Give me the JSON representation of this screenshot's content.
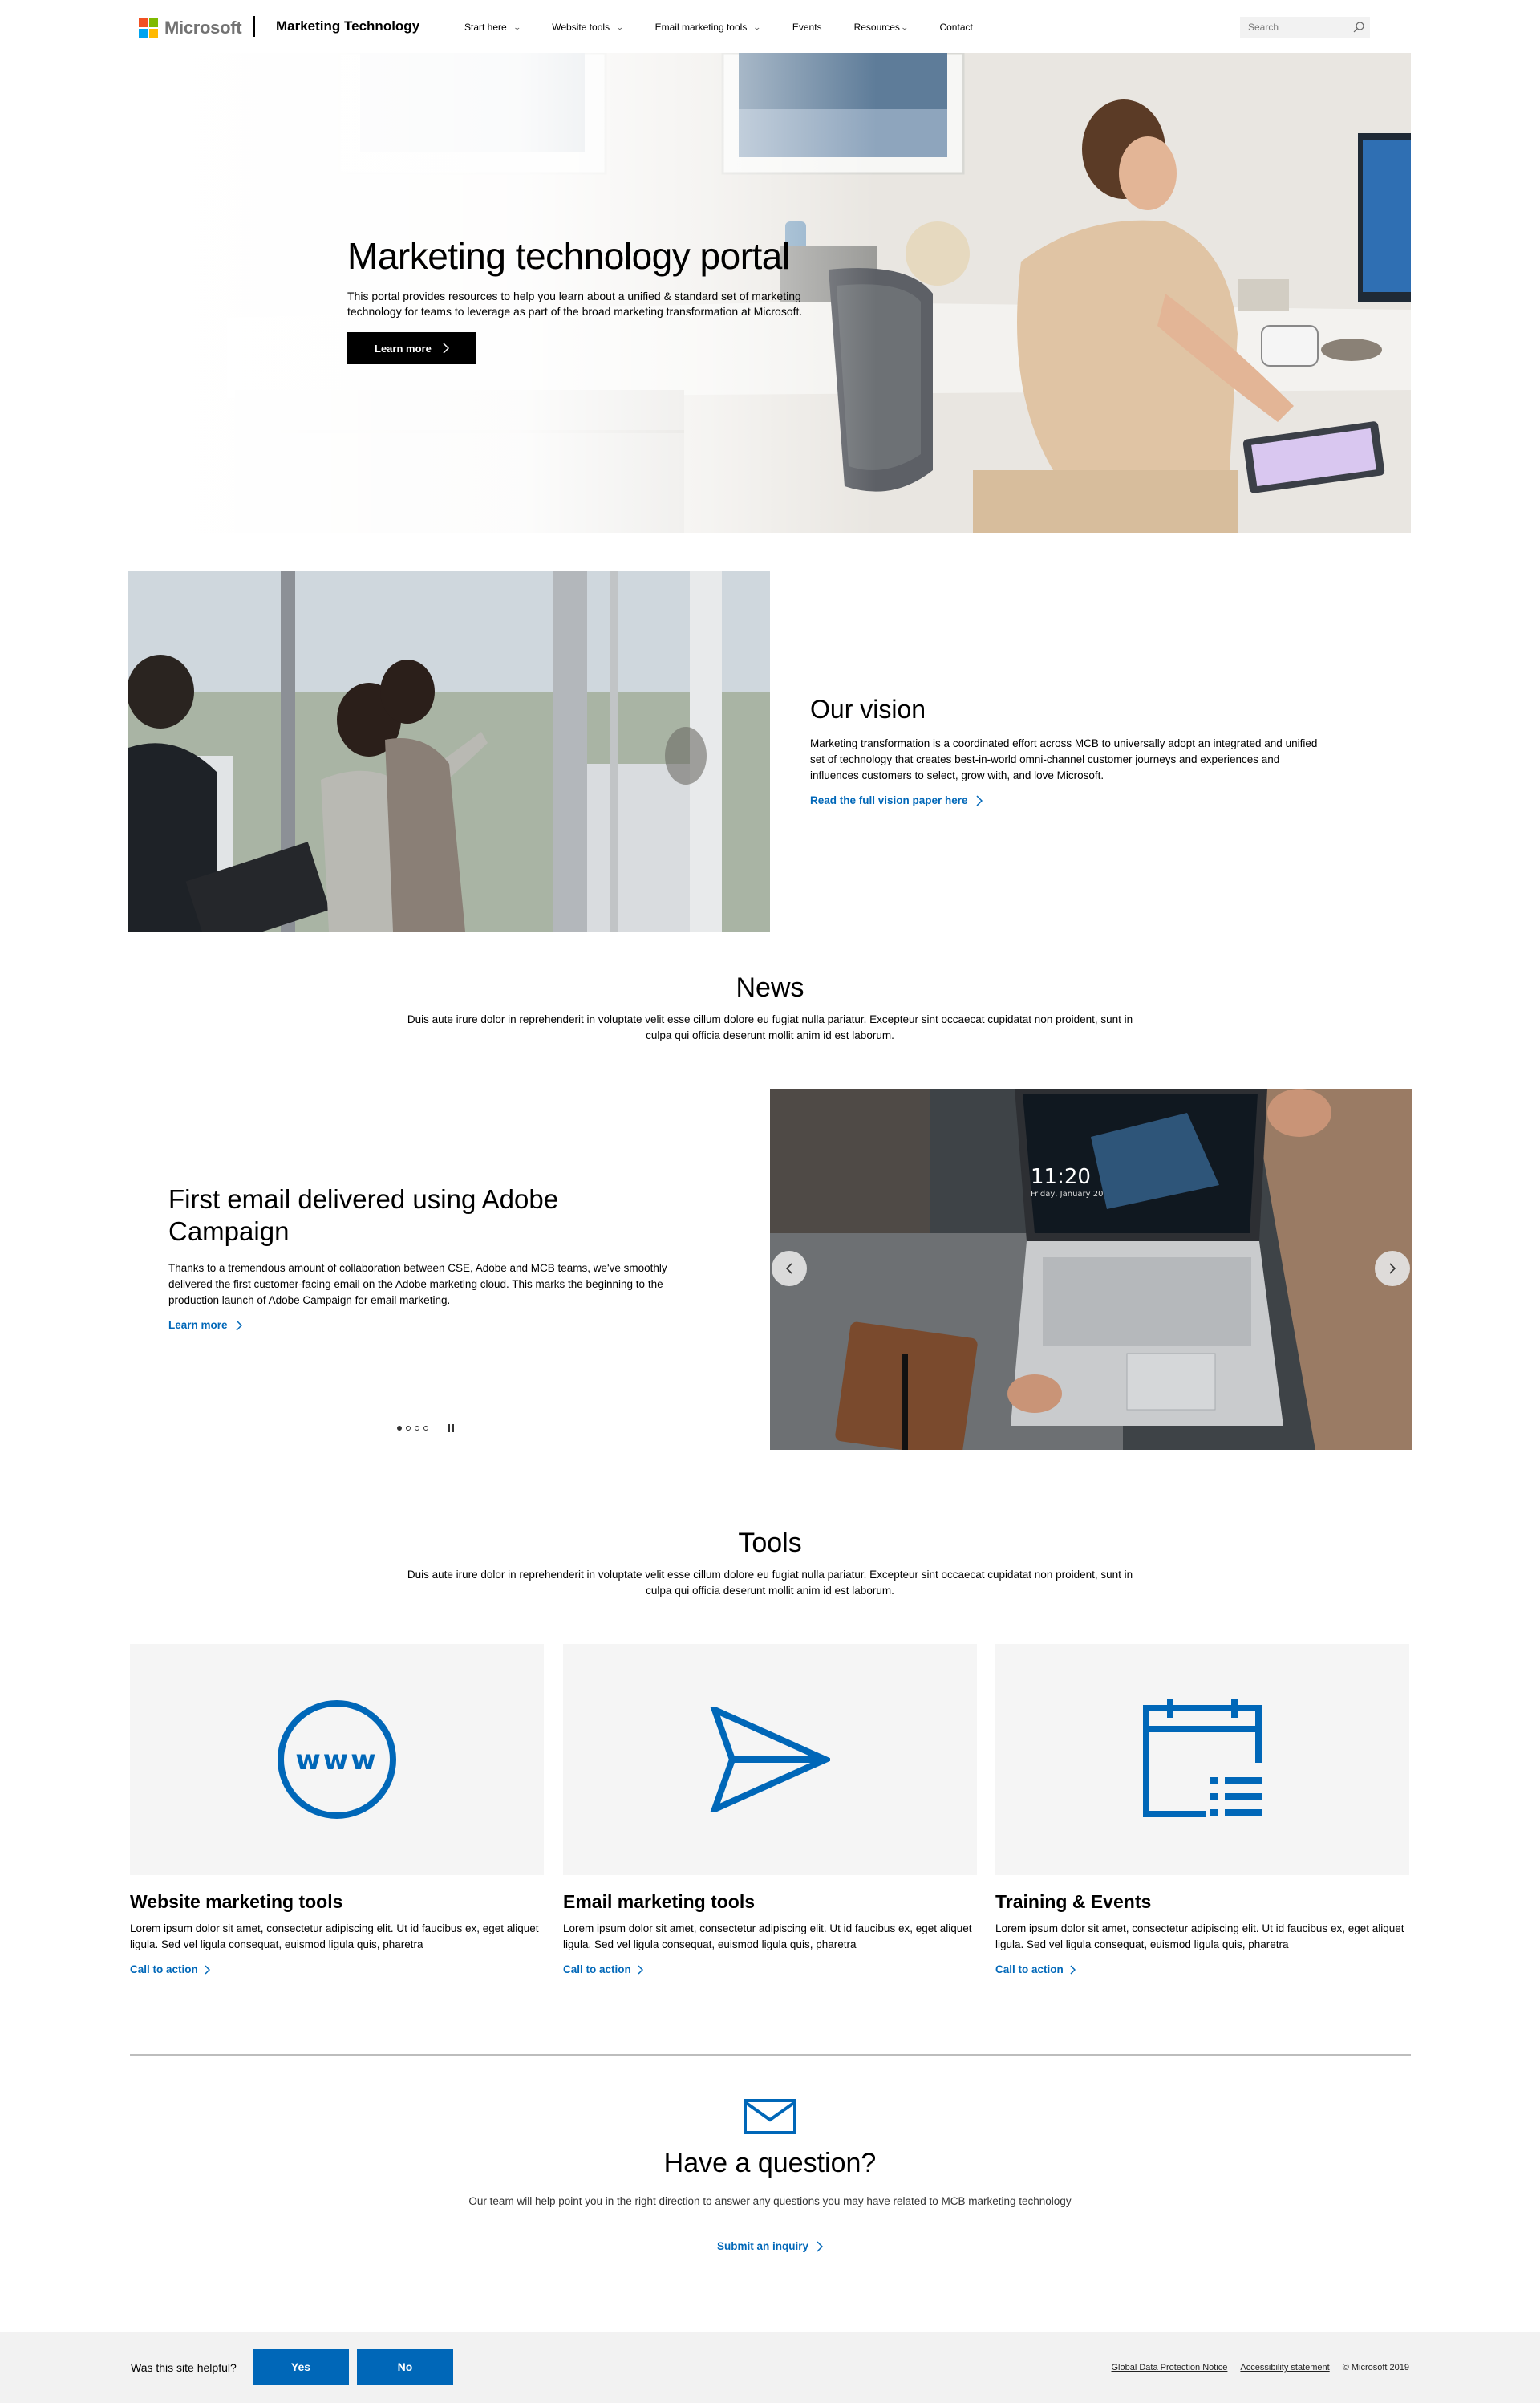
{
  "header": {
    "brand": "Microsoft",
    "site_title": "Marketing Technology",
    "nav": [
      {
        "label": "Start here",
        "has_dropdown": true
      },
      {
        "label": "Website tools",
        "has_dropdown": true
      },
      {
        "label": "Email marketing tools",
        "has_dropdown": true
      },
      {
        "label": "Events",
        "has_dropdown": false
      },
      {
        "label": "Resources",
        "has_dropdown": true
      },
      {
        "label": "Contact",
        "has_dropdown": false
      }
    ],
    "search_placeholder": "Search",
    "search_icon": "search-icon"
  },
  "hero": {
    "title": "Marketing technology portal",
    "description": "This portal provides resources to help you learn about a unified & standard set of marketing technology for teams to leverage as part of the broad marketing transformation at Microsoft.",
    "button_label": "Learn more"
  },
  "vision": {
    "title": "Our vision",
    "body": "Marketing transformation is a coordinated effort across MCB to universally adopt an integrated and unified set of technology that creates best-in-world omni-channel customer journeys and experiences and influences customers to select, grow with, and love Microsoft.",
    "link": "Read the full vision paper here"
  },
  "news": {
    "heading": "News",
    "intro": "Duis aute irure dolor in reprehenderit in voluptate velit esse cillum dolore eu fugiat nulla pariatur. Excepteur sint occaecat cupidatat non proident, sunt in culpa qui officia deserunt mollit anim id est laborum.",
    "slide": {
      "title": "First email delivered using Adobe Campaign",
      "body": "Thanks to a tremendous amount of collaboration between CSE, Adobe and MCB teams, we've smoothly delivered the first customer-facing email on the Adobe marketing cloud. This marks the beginning to the production launch of Adobe Campaign for email marketing.",
      "link": "Learn more",
      "laptop_time": "11:20",
      "laptop_date": "Friday, January 20"
    },
    "slide_count": 4,
    "active_slide": 1
  },
  "tools": {
    "heading": "Tools",
    "intro": "Duis aute irure dolor in reprehenderit in voluptate velit esse cillum dolore eu fugiat nulla pariatur. Excepteur sint occaecat cupidatat non proident, sunt in culpa qui officia deserunt mollit anim id est laborum.",
    "cards": [
      {
        "title": "Website marketing tools",
        "desc": "Lorem ipsum dolor sit amet, consectetur adipiscing elit. Ut id faucibus ex, eget aliquet ligula. Sed vel ligula consequat, euismod ligula quis, pharetra",
        "cta": "Call to action",
        "icon": "www-globe-icon",
        "icon_text": "www"
      },
      {
        "title": "Email marketing tools",
        "desc": "Lorem ipsum dolor sit amet, consectetur adipiscing elit. Ut id faucibus ex, eget aliquet ligula. Sed vel ligula consequat, euismod ligula quis, pharetra",
        "cta": "Call to action",
        "icon": "paper-plane-icon"
      },
      {
        "title": "Training & Events",
        "desc": "Lorem ipsum dolor sit amet, consectetur adipiscing elit. Ut id faucibus ex, eget aliquet ligula. Sed vel ligula consequat, euismod ligula quis, pharetra",
        "cta": "Call to action",
        "icon": "calendar-list-icon"
      }
    ]
  },
  "question": {
    "icon": "envelope-icon",
    "title": "Have a question?",
    "body": "Our team will help point you in the right direction to answer any questions you may have related to MCB marketing technology",
    "link": "Submit an inquiry"
  },
  "footer": {
    "helpful_label": "Was this site helpful?",
    "yes": "Yes",
    "no": "No",
    "links": [
      "Global Data Protection Notice",
      "Accessibility statement"
    ],
    "copyright": "© Microsoft 2019"
  },
  "colors": {
    "accent": "#0067b8",
    "ms_red": "#f25022",
    "ms_green": "#7fba00",
    "ms_blue": "#00a4ef",
    "ms_yellow": "#ffb900",
    "footer_bg": "#f2f2f2",
    "tile_bg": "#f5f5f5"
  }
}
